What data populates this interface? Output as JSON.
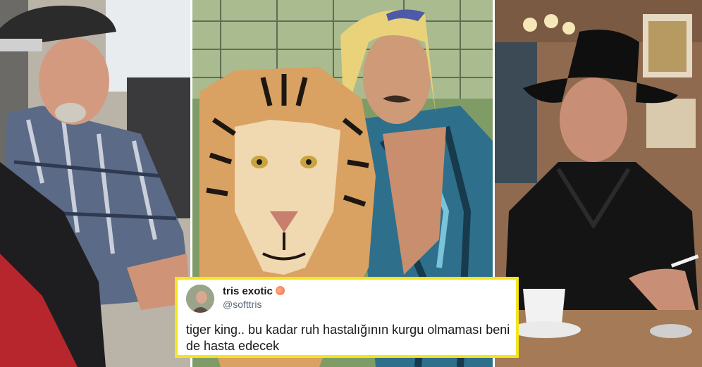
{
  "tweet": {
    "display_name": "tris exotic",
    "name_emoji": "peach-emoji",
    "handle": "@softtris",
    "text": "tiger king.. bu kadar ruh hastalığının kurgu olmaması beni de hasta edecek"
  },
  "colors": {
    "tweet_border": "#f5e51d",
    "handle": "#5b6b7a"
  }
}
